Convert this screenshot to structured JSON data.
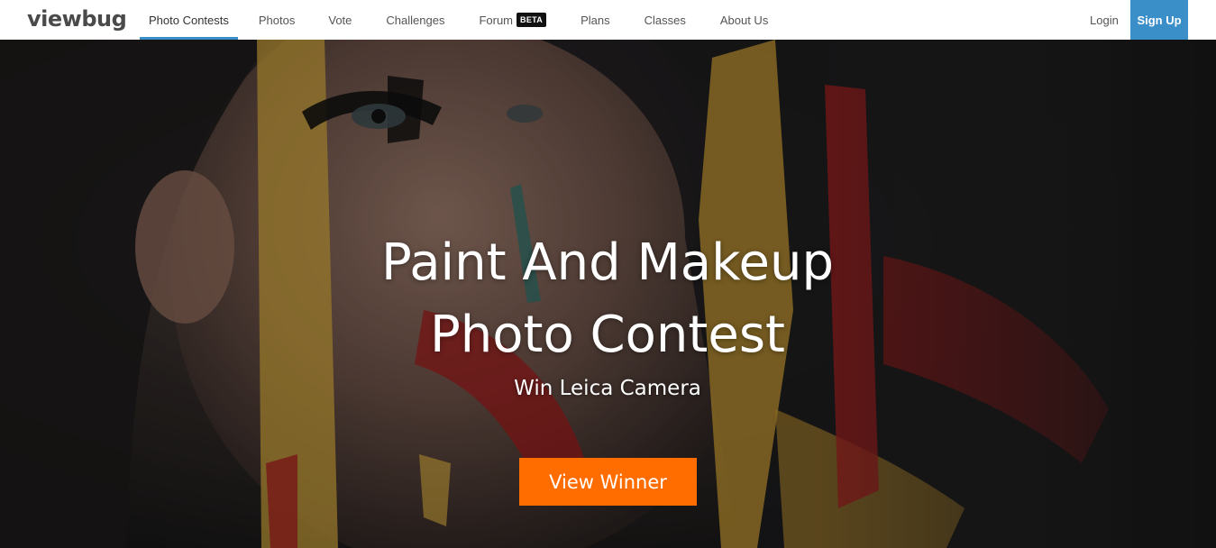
{
  "brand": {
    "logo_text": "viewbug",
    "accent": "#3a8fc9"
  },
  "nav": {
    "items": [
      {
        "label": "Photo Contests",
        "active": true
      },
      {
        "label": "Photos"
      },
      {
        "label": "Vote"
      },
      {
        "label": "Challenges"
      },
      {
        "label": "Forum",
        "badge": "BETA"
      },
      {
        "label": "Plans"
      },
      {
        "label": "Classes"
      },
      {
        "label": "About Us"
      }
    ],
    "login_label": "Login",
    "signup_label": "Sign Up"
  },
  "hero": {
    "title_line1": "Paint And Makeup",
    "title_line2": "Photo Contest",
    "subtitle": "Win Leica Camera",
    "cta_label": "View Winner",
    "cta_color": "#ff6c00"
  }
}
